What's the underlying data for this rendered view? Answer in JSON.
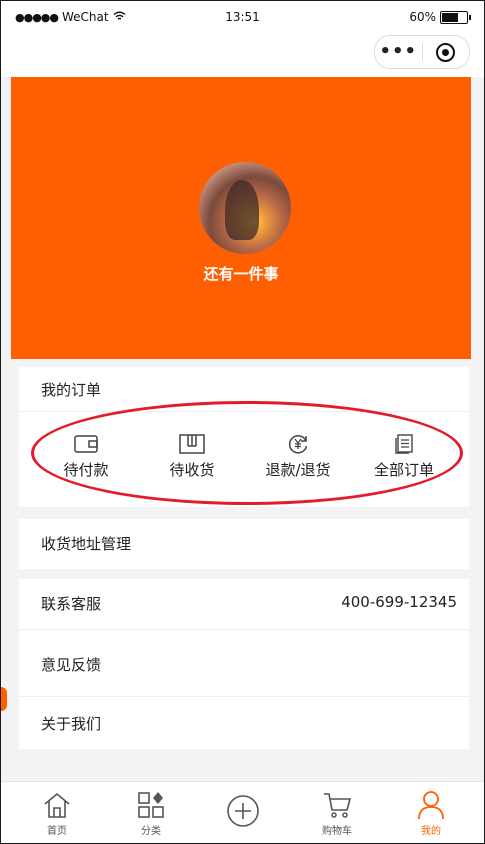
{
  "status_bar": {
    "carrier": "WeChat",
    "time": "13:51",
    "battery": "60%",
    "battery_level": 0.6
  },
  "profile": {
    "nickname": "还有一件事"
  },
  "orders": {
    "title": "我的订单",
    "items": [
      {
        "label": "待付款",
        "icon": "wallet-icon"
      },
      {
        "label": "待收货",
        "icon": "package-icon"
      },
      {
        "label": "退款/退货",
        "icon": "yuan-refund-icon"
      },
      {
        "label": "全部订单",
        "icon": "order-list-icon"
      }
    ]
  },
  "menu": {
    "address": "收货地址管理",
    "service_label": "联系客服",
    "service_phone": "400-699-12345",
    "feedback": "意见反馈",
    "about": "关于我们"
  },
  "tabbar": {
    "items": [
      {
        "label": "首页",
        "icon": "home-icon"
      },
      {
        "label": "分类",
        "icon": "category-grid-icon"
      },
      {
        "label": "",
        "icon": "plus-circle-icon"
      },
      {
        "label": "购物车",
        "icon": "cart-icon"
      },
      {
        "label": "我的",
        "icon": "person-icon"
      }
    ],
    "active_color": "#ff5f00"
  },
  "colors": {
    "brand": "#ff5f00",
    "annotation": "#e41c2a"
  }
}
